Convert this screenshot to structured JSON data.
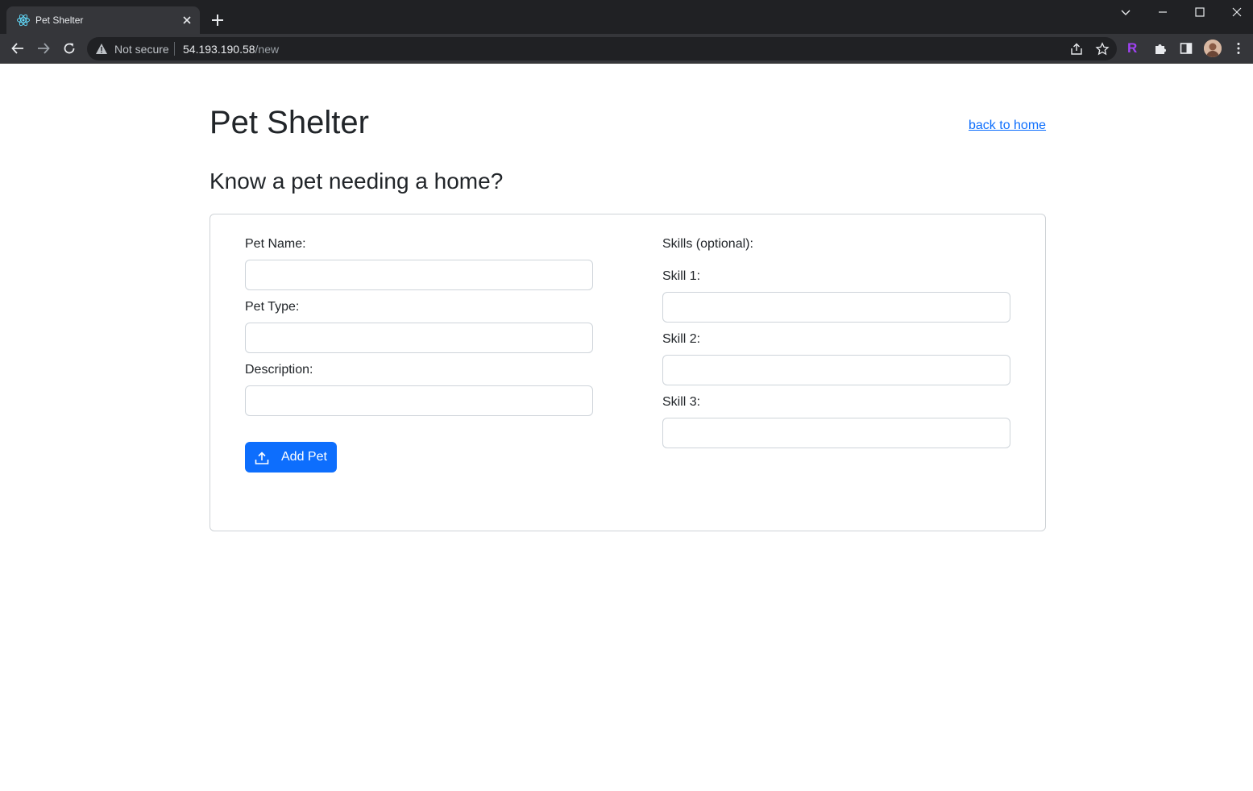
{
  "browser": {
    "tab_title": "Pet Shelter",
    "security_label": "Not secure",
    "url_host": "54.193.190.58",
    "url_path": "/new",
    "extension_letter": "R"
  },
  "page": {
    "title": "Pet Shelter",
    "home_link": "back to home",
    "subtitle": "Know a pet needing a home?"
  },
  "form": {
    "pet_name_label": "Pet Name:",
    "pet_type_label": "Pet Type:",
    "description_label": "Description:",
    "pet_name_value": "",
    "pet_type_value": "",
    "description_value": "",
    "skills_heading": "Skills (optional):",
    "skill1_label": "Skill 1:",
    "skill2_label": "Skill 2:",
    "skill3_label": "Skill 3:",
    "skill1_value": "",
    "skill2_value": "",
    "skill3_value": "",
    "submit_label": "Add Pet"
  },
  "colors": {
    "primary": "#0d6efd",
    "text": "#212529",
    "chrome_dark": "#202124",
    "chrome_toolbar": "#35363a"
  }
}
